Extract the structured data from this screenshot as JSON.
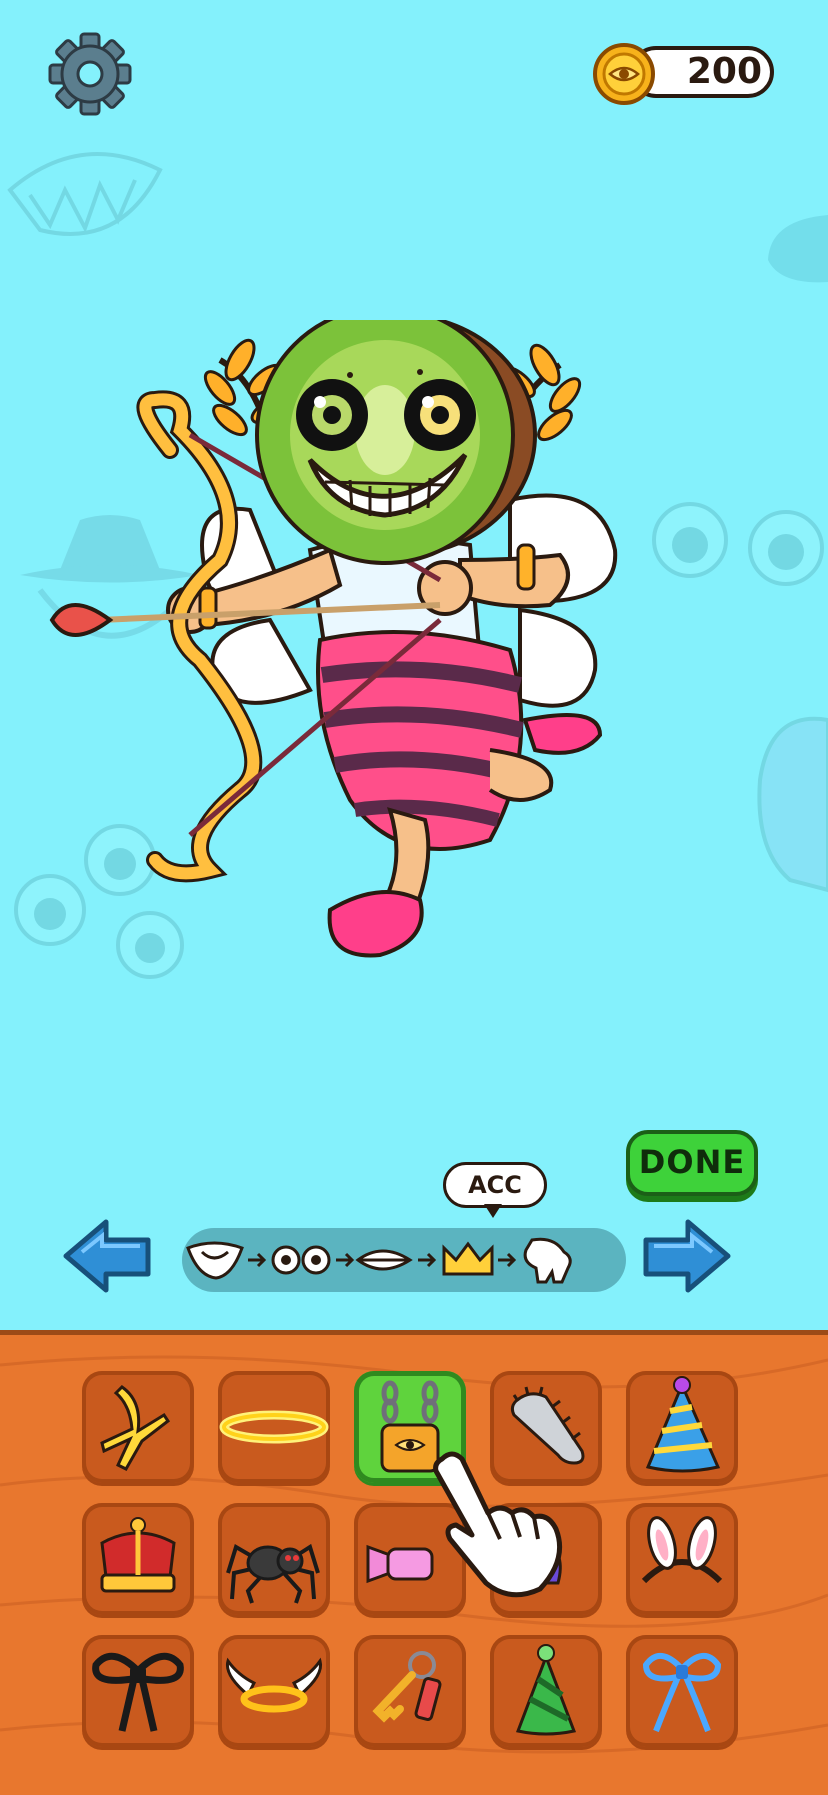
{
  "header": {
    "settings_icon": "gear-icon",
    "coins": {
      "value": "200",
      "icon": "coin-eye-icon"
    }
  },
  "editor": {
    "done_label": "DONE",
    "current_step_label": "ACC",
    "steps": [
      "mouth-shape-icon",
      "eyes-icon",
      "lips-icon",
      "crown-icon",
      "glove-icon"
    ],
    "prev_icon": "arrow-left-icon",
    "next_icon": "arrow-right-icon"
  },
  "items": [
    {
      "name": "banana-peel",
      "selected": false
    },
    {
      "name": "halo",
      "selected": false
    },
    {
      "name": "chain-padlock",
      "selected": true
    },
    {
      "name": "chainsaw-blade",
      "selected": false
    },
    {
      "name": "party-hat-blue",
      "selected": false
    },
    {
      "name": "royal-crown",
      "selected": false
    },
    {
      "name": "spider",
      "selected": false
    },
    {
      "name": "candy",
      "selected": false
    },
    {
      "name": "purple-item",
      "selected": false
    },
    {
      "name": "bunny-ears",
      "selected": false
    },
    {
      "name": "black-bow",
      "selected": false
    },
    {
      "name": "winged-halo",
      "selected": false
    },
    {
      "name": "keys",
      "selected": false
    },
    {
      "name": "party-hat-green",
      "selected": false
    },
    {
      "name": "blue-bow",
      "selected": false
    }
  ],
  "colors": {
    "background": "#84F1FC",
    "panel": "#E8772E",
    "slot": "#C95A1E",
    "selected_slot": "#5fd33d",
    "done_button": "#3ed23a",
    "arrow": "#2f8fd6"
  }
}
